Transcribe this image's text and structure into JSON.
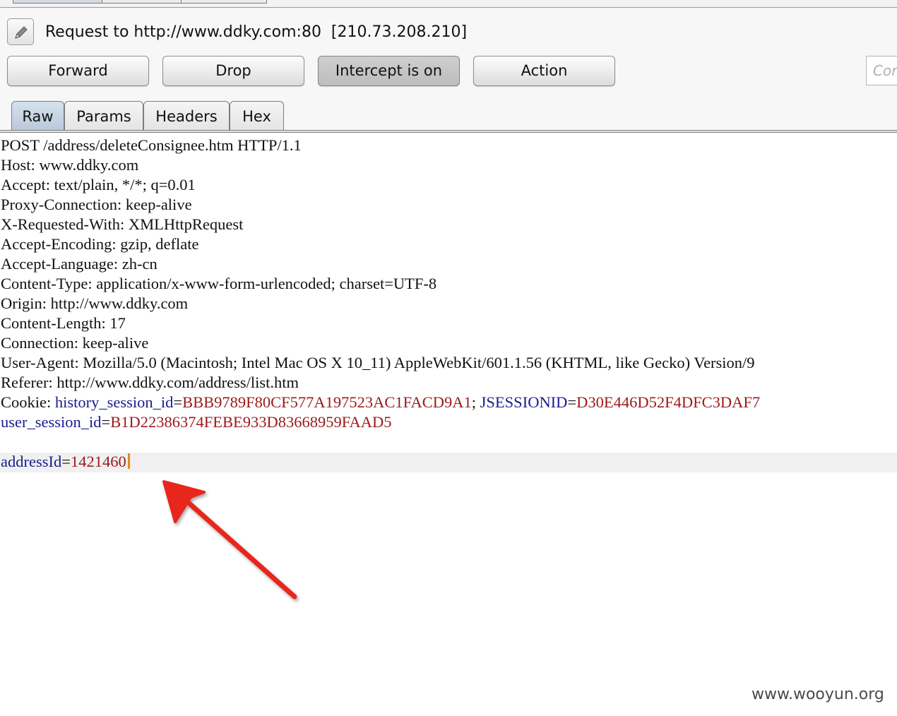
{
  "header": {
    "request_title": "Request to http://www.ddky.com:80  [210.73.208.210]",
    "edit_icon": "pencil-icon"
  },
  "toolbar": {
    "forward_label": "Forward",
    "drop_label": "Drop",
    "intercept_label": "Intercept is on",
    "action_label": "Action",
    "search_placeholder": "Comment this item"
  },
  "tabs": [
    {
      "label": "Raw",
      "active": true
    },
    {
      "label": "Params",
      "active": false
    },
    {
      "label": "Headers",
      "active": false
    },
    {
      "label": "Hex",
      "active": false
    }
  ],
  "request": {
    "request_line": "POST /address/deleteConsignee.htm HTTP/1.1",
    "headers": [
      "Host: www.ddky.com",
      "Accept: text/plain, */*; q=0.01",
      "Proxy-Connection: keep-alive",
      "X-Requested-With: XMLHttpRequest",
      "Accept-Encoding: gzip, deflate",
      "Accept-Language: zh-cn",
      "Content-Type: application/x-www-form-urlencoded; charset=UTF-8",
      "Origin: http://www.ddky.com",
      "Content-Length: 17",
      "Connection: keep-alive",
      "User-Agent: Mozilla/5.0 (Macintosh; Intel Mac OS X 10_11) AppleWebKit/601.1.56 (KHTML, like Gecko) Version/9",
      "Referer: http://www.ddky.com/address/list.htm"
    ],
    "cookie": {
      "label": "Cookie: ",
      "history_key": "history_session_id",
      "history_value": "BBB9789F80CF577A197523AC1FACD9A1",
      "separator": "; ",
      "jsession_key": "JSESSIONID",
      "jsession_value": "D30E446D52F4DFC3DAF7",
      "user_key": "user_session_id",
      "user_value": "B1D22386374FEBE933D83668959FAAD5"
    },
    "body": {
      "param_key": "addressId",
      "param_value": "1421460"
    }
  },
  "colors": {
    "param_key": "#1b1b8f",
    "param_value": "#9b1a1a",
    "annotation_arrow": "#e8271f",
    "caret": "#e08a1e"
  },
  "watermark": "www.wooyun.org"
}
